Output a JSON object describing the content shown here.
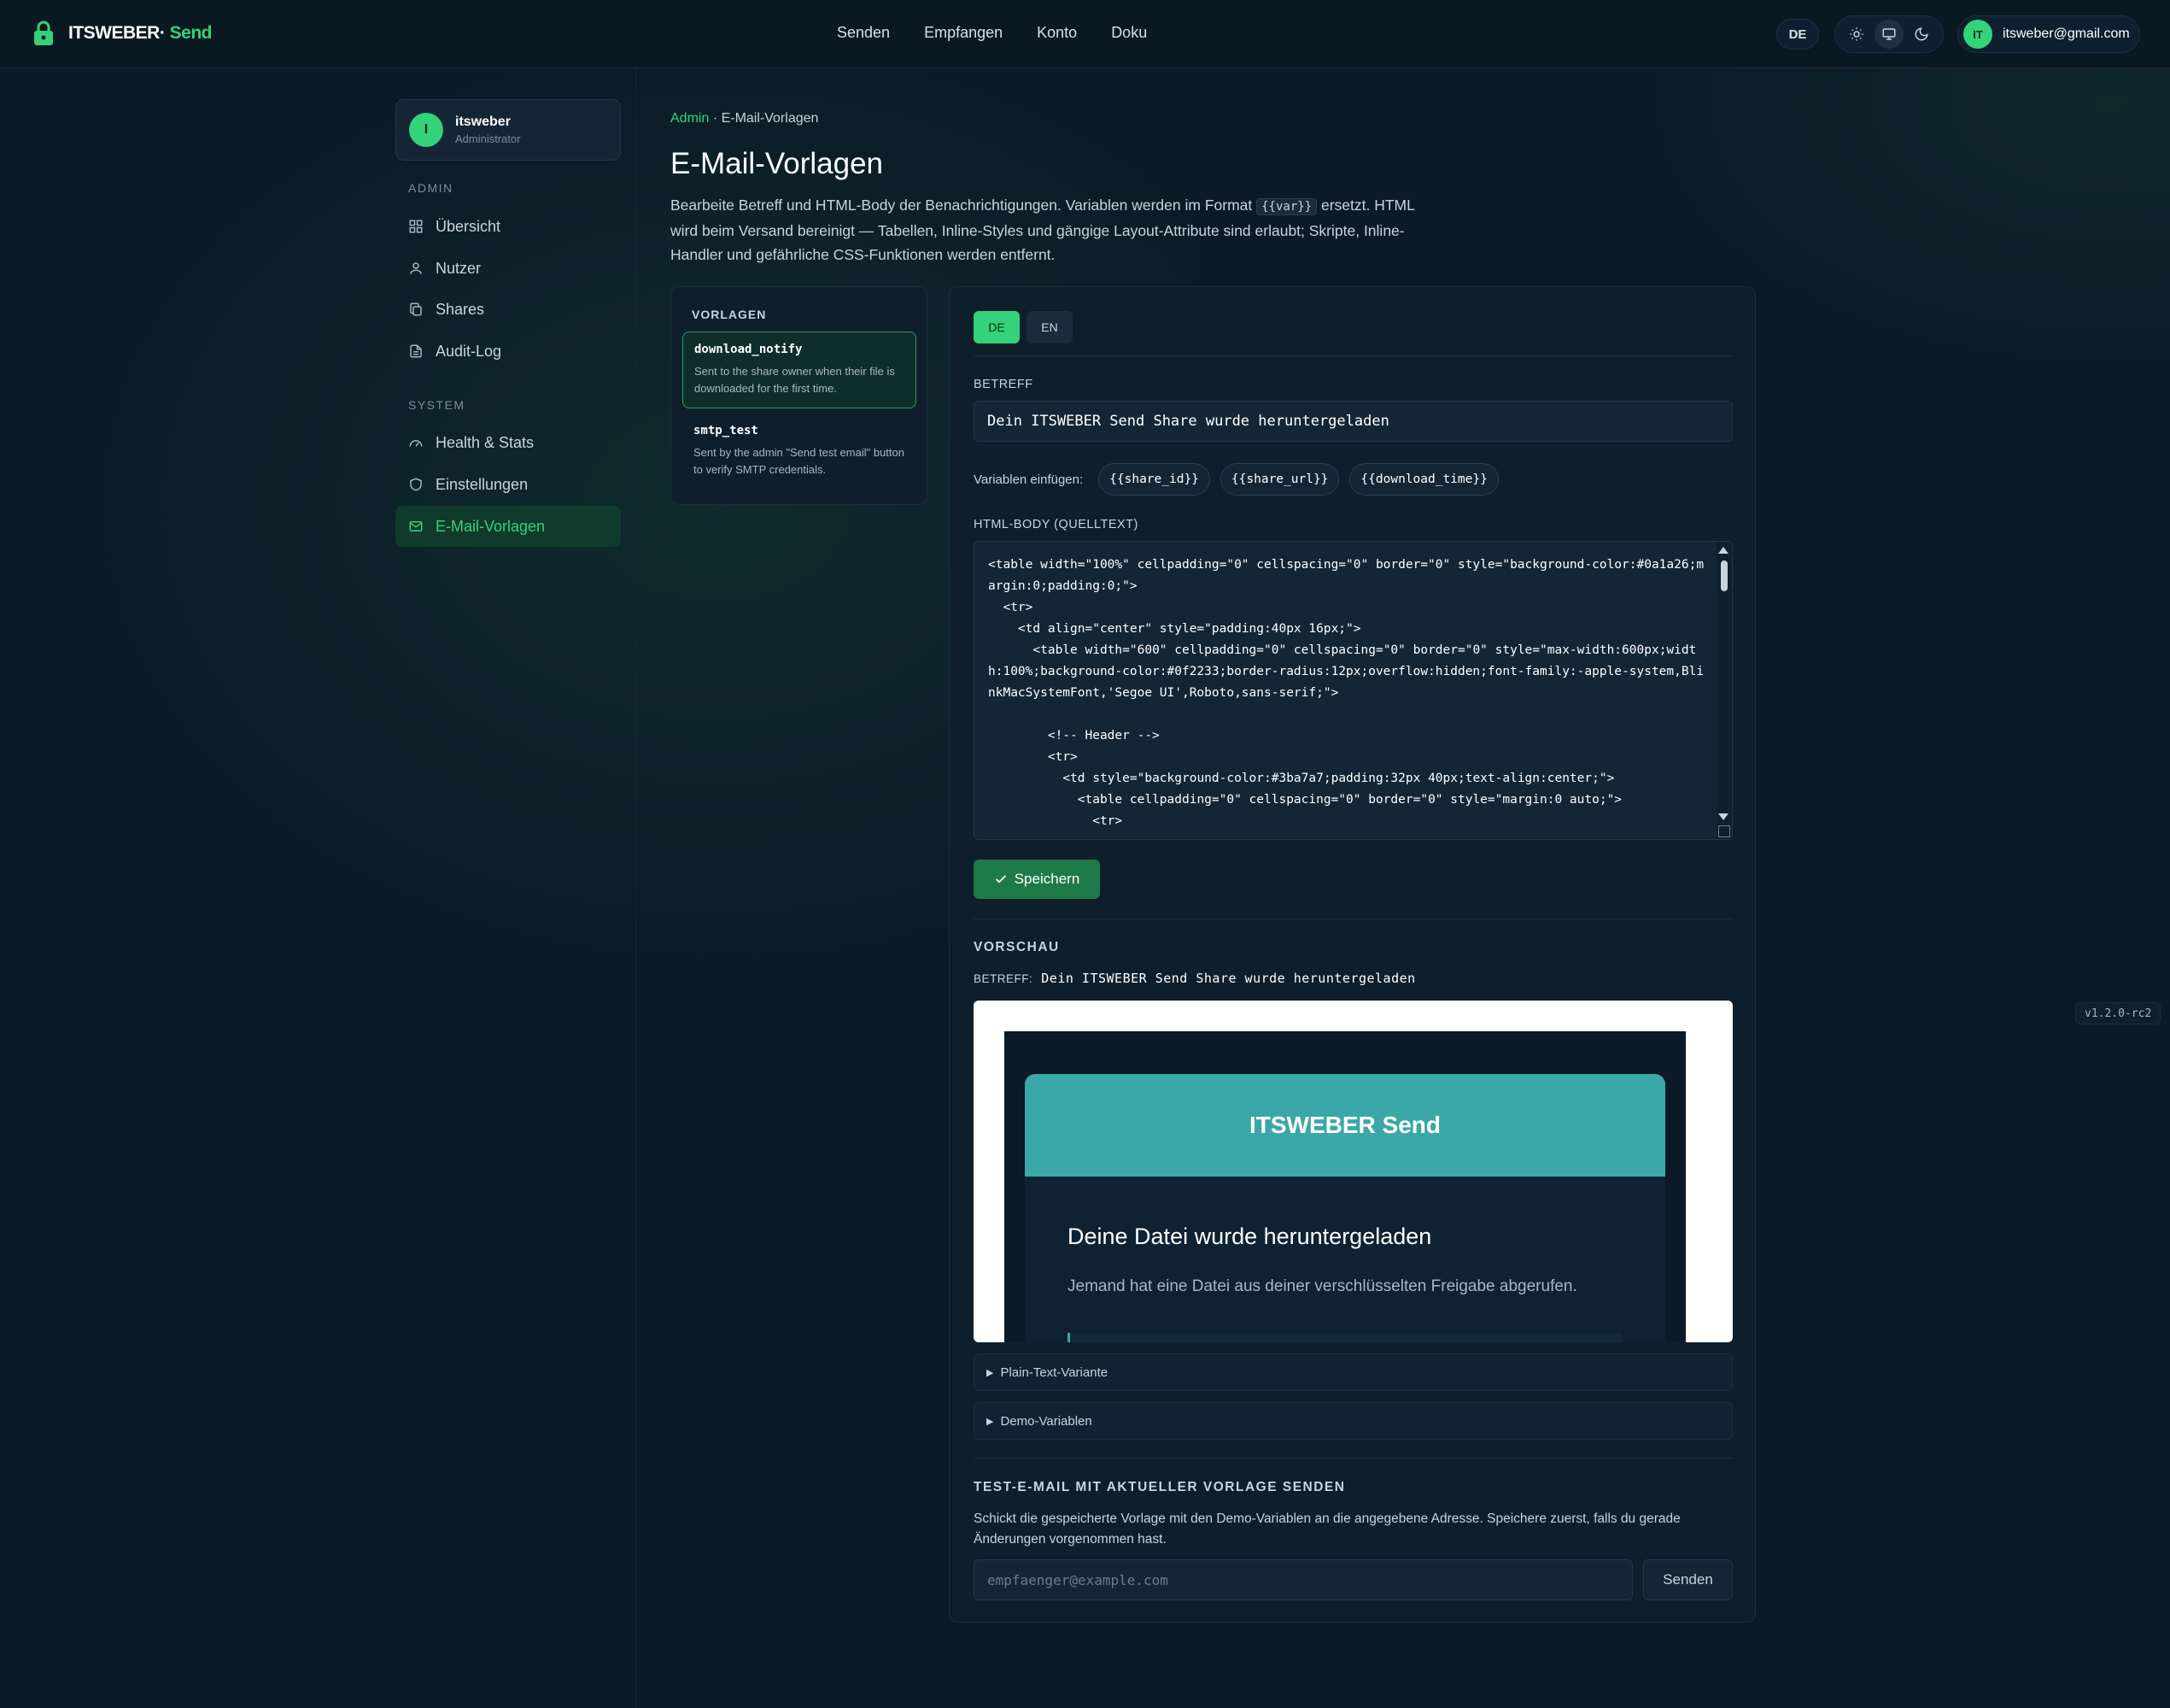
{
  "header": {
    "brand_main": "ITSWEBER·",
    "brand_accent": " Send",
    "nav": [
      "Senden",
      "Empfangen",
      "Konto",
      "Doku"
    ],
    "lang": "DE",
    "user_initials": "IT",
    "user_email": "itsweber@gmail.com"
  },
  "sidebar": {
    "profile": {
      "initial": "I",
      "name": "itsweber",
      "role": "Administrator"
    },
    "admin_section": "ADMIN",
    "admin_items": [
      "Übersicht",
      "Nutzer",
      "Shares",
      "Audit-Log"
    ],
    "system_section": "SYSTEM",
    "system_items": [
      "Health & Stats",
      "Einstellungen",
      "E-Mail-Vorlagen"
    ]
  },
  "breadcrumb": {
    "link": "Admin",
    "sep": " · ",
    "current": "E-Mail-Vorlagen"
  },
  "page": {
    "title": "E-Mail-Vorlagen",
    "desc_before": "Bearbeite Betreff und HTML-Body der Benachrichtigungen. Variablen werden im Format ",
    "desc_code": "{{var}}",
    "desc_after": " ersetzt. HTML wird beim Versand bereinigt — Tabellen, Inline-Styles und gängige Layout-Attribute sind erlaubt; Skripte, Inline-Handler und gefährliche CSS-Funktionen werden entfernt."
  },
  "templates": {
    "heading": "VORLAGEN",
    "items": [
      {
        "name": "download_notify",
        "desc": "Sent to the share owner when their file is downloaded for the first time."
      },
      {
        "name": "smtp_test",
        "desc": "Sent by the admin \"Send test email\" button to verify SMTP credentials."
      }
    ]
  },
  "editor": {
    "lang_tabs": [
      "DE",
      "EN"
    ],
    "subject_label": "BETREFF",
    "subject_value": "Dein ITSWEBER Send Share wurde heruntergeladen",
    "vars_label": "Variablen einfügen:",
    "vars": [
      "{{share_id}}",
      "{{share_url}}",
      "{{download_time}}"
    ],
    "body_label": "HTML-BODY (QUELLTEXT)",
    "body_code": "<table width=\"100%\" cellpadding=\"0\" cellspacing=\"0\" border=\"0\" style=\"background-color:#0a1a26;margin:0;padding:0;\">\n  <tr>\n    <td align=\"center\" style=\"padding:40px 16px;\">\n      <table width=\"600\" cellpadding=\"0\" cellspacing=\"0\" border=\"0\" style=\"max-width:600px;width:100%;background-color:#0f2233;border-radius:12px;overflow:hidden;font-family:-apple-system,BlinkMacSystemFont,'Segoe UI',Roboto,sans-serif;\">\n\n        <!-- Header -->\n        <tr>\n          <td style=\"background-color:#3ba7a7;padding:32px 40px;text-align:center;\">\n            <table cellpadding=\"0\" cellspacing=\"0\" border=\"0\" style=\"margin:0 auto;\">\n              <tr>",
    "save_label": "Speichern"
  },
  "preview": {
    "heading": "VORSCHAU",
    "subject_label": "BETREFF:",
    "subject_value": "Dein ITSWEBER Send Share wurde heruntergeladen",
    "brand": "ITSWEBER Send",
    "title": "Deine Datei wurde heruntergeladen",
    "text": "Jemand hat eine Datei aus deiner verschlüsselten Freigabe abgerufen."
  },
  "details": [
    "Plain-Text-Variante",
    "Demo-Variablen"
  ],
  "test": {
    "heading": "TEST-E-MAIL MIT AKTUELLER VORLAGE SENDEN",
    "desc": "Schickt die gespeicherte Vorlage mit den Demo-Variablen an die angegebene Adresse. Speichere zuerst, falls du gerade Änderungen vorgenommen hast.",
    "placeholder": "empfaenger@example.com",
    "send_label": "Senden"
  },
  "version": "v1.2.0-rc2",
  "colors": {
    "accent": "#34d27a",
    "background": "#0b1a26",
    "preview_header": "#3ba7a7"
  }
}
